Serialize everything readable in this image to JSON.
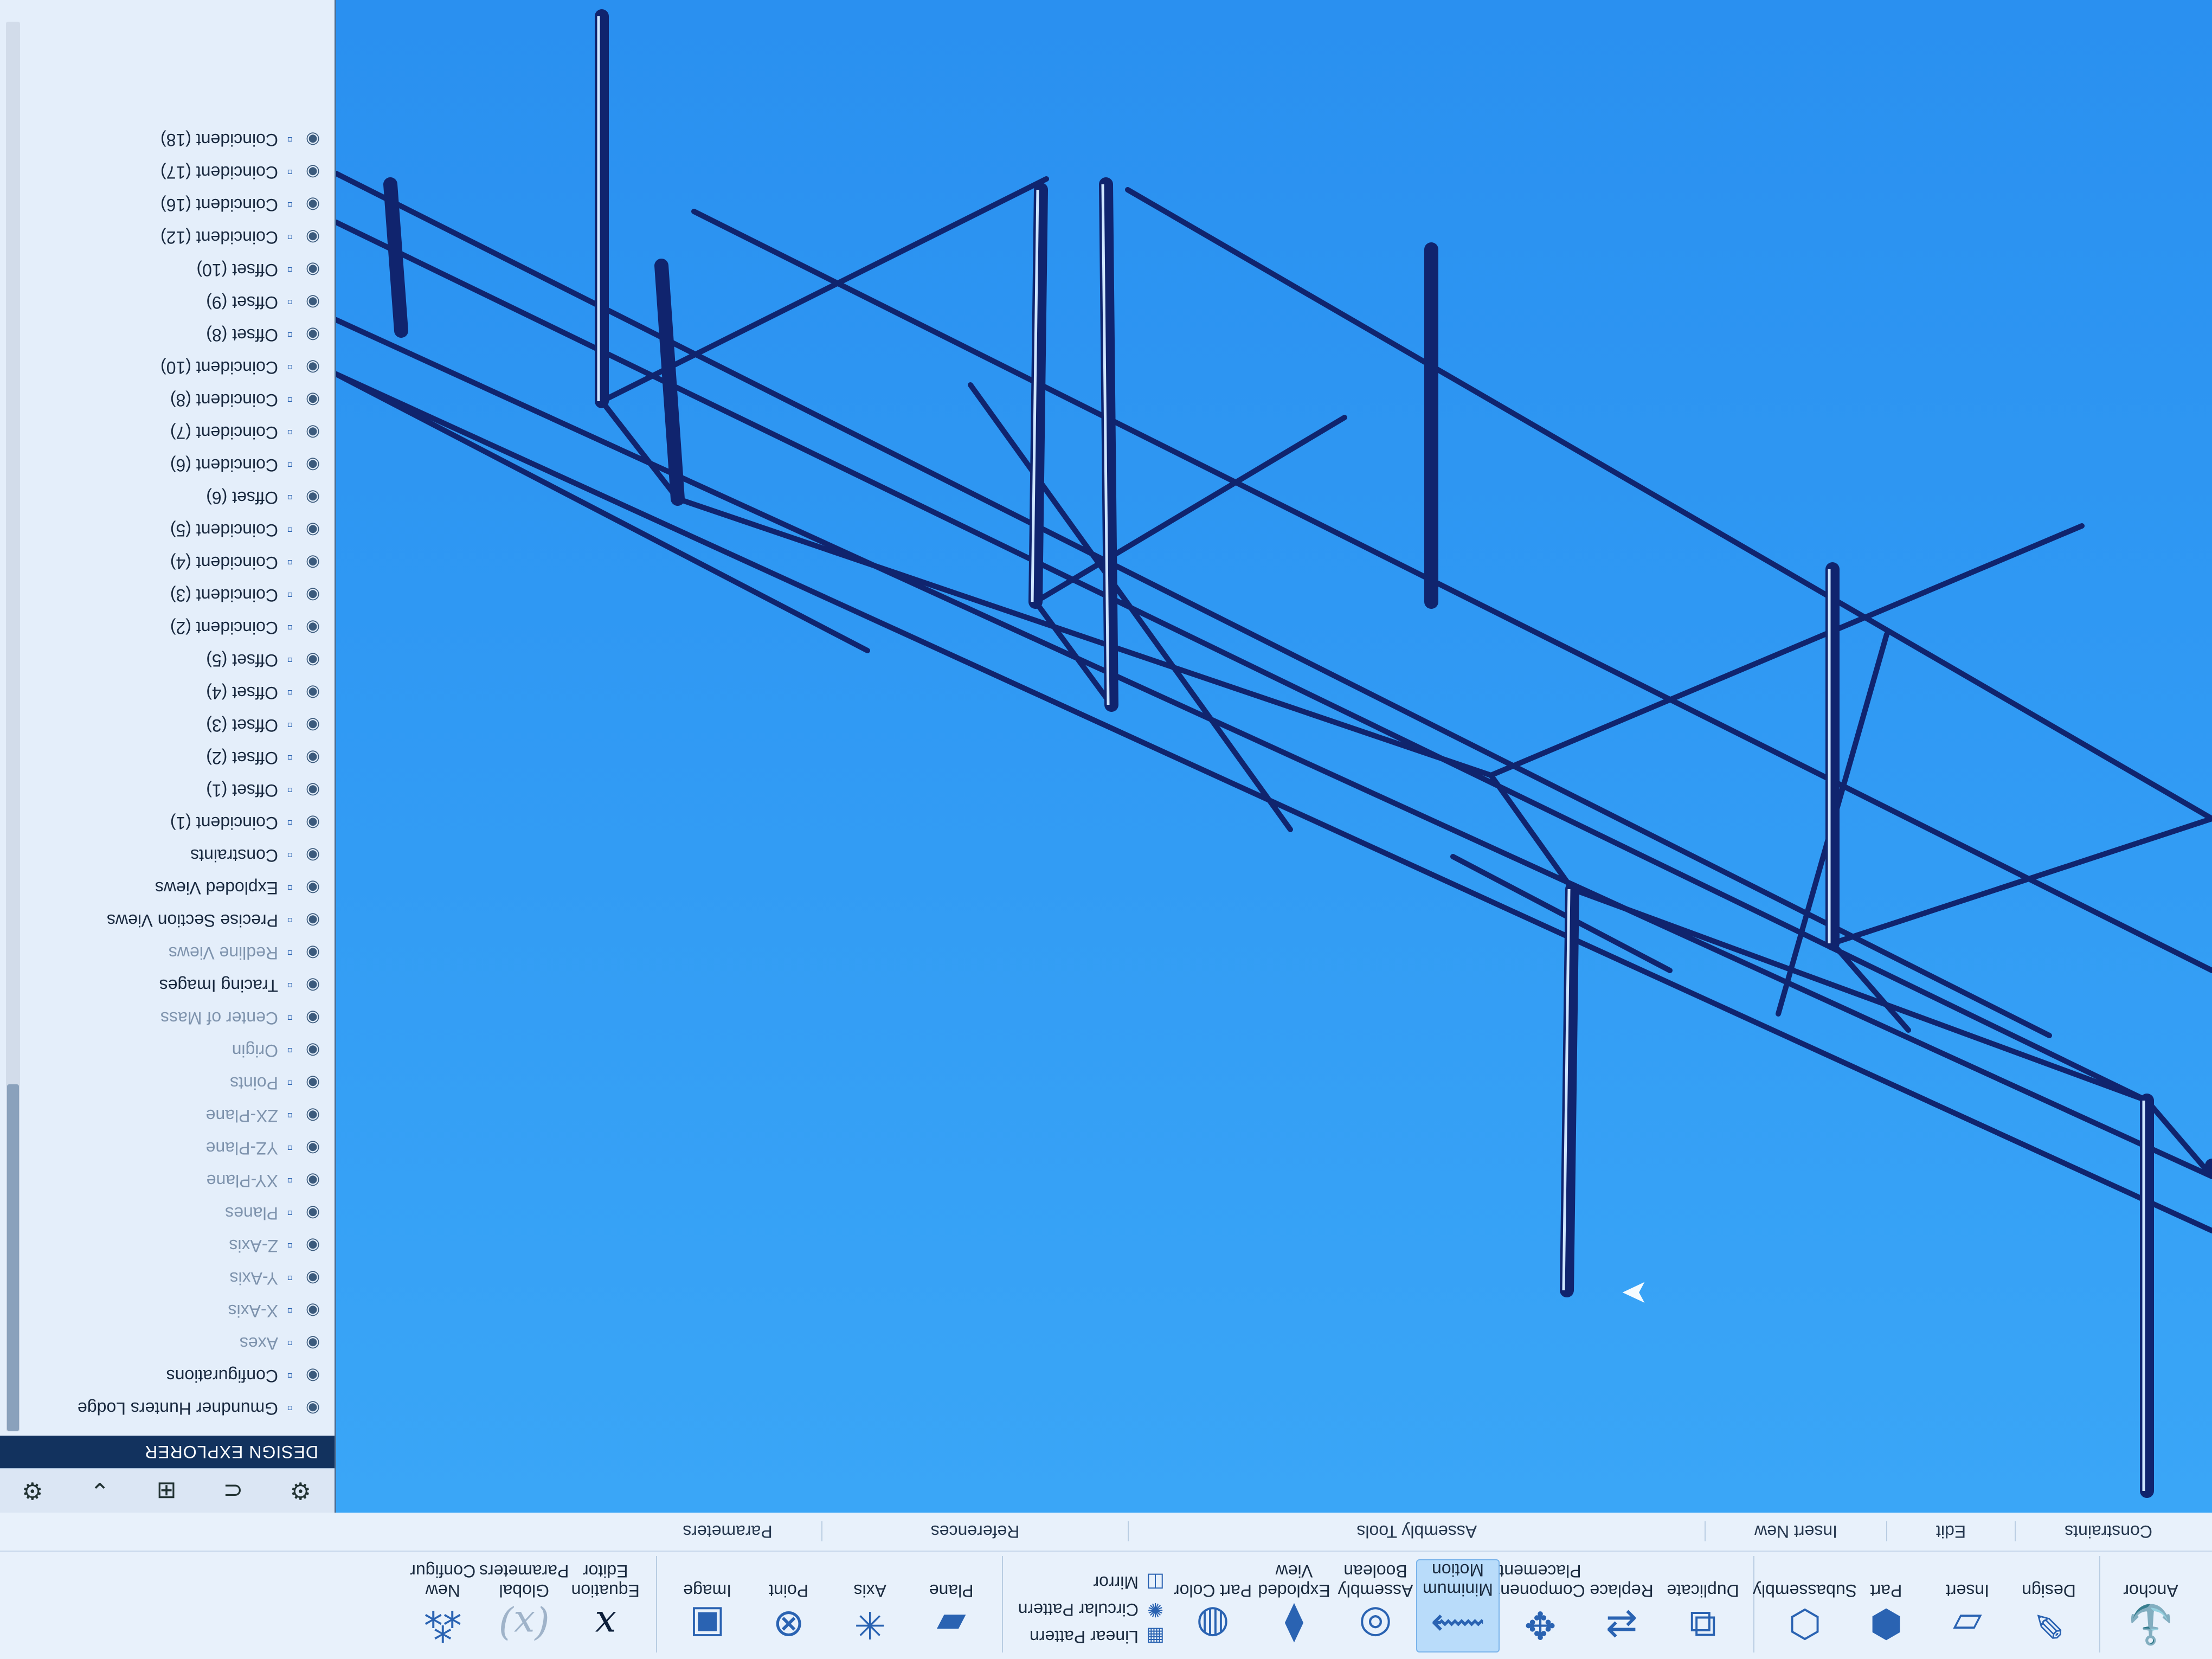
{
  "colors": {
    "viewport_bg": "#2f98f3",
    "frame_stroke": "#10246e",
    "ribbon_bg": "#e8f1fb",
    "explorer_header": "#12325e"
  },
  "ribbon": {
    "buttons": [
      {
        "label": "Anchor",
        "icon": "anchor-icon"
      },
      {
        "label": "Design",
        "icon": "design-icon"
      },
      {
        "label": "Insert",
        "icon": "insert-icon"
      },
      {
        "label": "Part",
        "icon": "part-icon"
      },
      {
        "label": "Subassembly",
        "icon": "subassembly-icon"
      },
      {
        "label": "Duplicate",
        "icon": "duplicate-icon"
      },
      {
        "label": "Replace",
        "icon": "replace-icon"
      },
      {
        "label": "Component Placement",
        "icon": "component-placement-icon"
      },
      {
        "label": "Minimum Motion",
        "icon": "minimum-motion-icon"
      },
      {
        "label": "Assembly Boolean",
        "icon": "assembly-boolean-icon"
      },
      {
        "label": "Exploded View",
        "icon": "exploded-view-icon"
      },
      {
        "label": "Part Color",
        "icon": "part-color-icon"
      }
    ],
    "small_tools": [
      {
        "label": "Linear Pattern",
        "icon": "linear-pattern-icon"
      },
      {
        "label": "Circular Pattern",
        "icon": "circular-pattern-icon"
      },
      {
        "label": "Mirror",
        "icon": "mirror-icon"
      }
    ],
    "ref_buttons": [
      {
        "label": "Plane",
        "icon": "plane-icon"
      },
      {
        "label": "Axis",
        "icon": "axis-icon"
      },
      {
        "label": "Point",
        "icon": "point-icon"
      },
      {
        "label": "Image",
        "icon": "image-icon"
      }
    ],
    "param_buttons": [
      {
        "label": "Equation Editor",
        "icon": "equation-editor-icon"
      },
      {
        "label": "Global Parameters",
        "icon": "global-parameters-icon"
      },
      {
        "label": "New Configur",
        "icon": "new-configuration-icon"
      }
    ],
    "groups": [
      "Constraints",
      "Edit",
      "Insert New",
      "Assembly Tools",
      "References",
      "Parameters"
    ]
  },
  "explorer": {
    "title": "DESIGN EXPLORER",
    "toolbar_icons": [
      "settings-icon",
      "magnet-icon",
      "view-icon",
      "chevron-icon",
      "gear-icon"
    ],
    "items": [
      {
        "label": "Gmundner Hunters Lodge",
        "dim": false
      },
      {
        "label": "Configurations",
        "dim": false
      },
      {
        "label": "Axes",
        "dim": true
      },
      {
        "label": "X-Axis",
        "dim": true
      },
      {
        "label": "Y-Axis",
        "dim": true
      },
      {
        "label": "Z-Axis",
        "dim": true
      },
      {
        "label": "Planes",
        "dim": true
      },
      {
        "label": "XY-Plane",
        "dim": true
      },
      {
        "label": "YZ-Plane",
        "dim": true
      },
      {
        "label": "ZX-Plane",
        "dim": true
      },
      {
        "label": "Points",
        "dim": true
      },
      {
        "label": "Origin",
        "dim": true
      },
      {
        "label": "Center of Mass",
        "dim": true
      },
      {
        "label": "Tracing Images",
        "dim": false
      },
      {
        "label": "Redline Views",
        "dim": true
      },
      {
        "label": "Precise Section Views",
        "dim": false
      },
      {
        "label": "Exploded Views",
        "dim": false
      },
      {
        "label": "Constraints",
        "dim": false
      },
      {
        "label": "Coincident (1)",
        "dim": false
      },
      {
        "label": "Offset (1)",
        "dim": false
      },
      {
        "label": "Offset (2)",
        "dim": false
      },
      {
        "label": "Offset (3)",
        "dim": false
      },
      {
        "label": "Offset (4)",
        "dim": false
      },
      {
        "label": "Offset (5)",
        "dim": false
      },
      {
        "label": "Coincident (2)",
        "dim": false
      },
      {
        "label": "Coincident (3)",
        "dim": false
      },
      {
        "label": "Coincident (4)",
        "dim": false
      },
      {
        "label": "Coincident (5)",
        "dim": false
      },
      {
        "label": "Offset (6)",
        "dim": false
      },
      {
        "label": "Coincident (6)",
        "dim": false
      },
      {
        "label": "Coincident (7)",
        "dim": false
      },
      {
        "label": "Coincident (8)",
        "dim": false
      },
      {
        "label": "Coincident (10)",
        "dim": false
      },
      {
        "label": "Offset (8)",
        "dim": false
      },
      {
        "label": "Offset (9)",
        "dim": false
      },
      {
        "label": "Offset (10)",
        "dim": false
      },
      {
        "label": "Coincident (12)",
        "dim": false
      },
      {
        "label": "Coincident (16)",
        "dim": false
      },
      {
        "label": "Coincident (17)",
        "dim": false
      },
      {
        "label": "Coincident (18)",
        "dim": false
      }
    ]
  }
}
